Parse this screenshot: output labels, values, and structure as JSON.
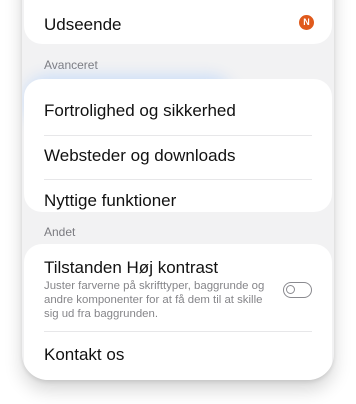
{
  "appearance": {
    "label": "Udseende",
    "badge": "N"
  },
  "advanced": {
    "header": "Avanceret",
    "items": [
      {
        "label": "Fortrolighed og sikkerhed"
      },
      {
        "label": "Websteder og downloads"
      },
      {
        "label": "Nyttige funktioner"
      }
    ]
  },
  "other": {
    "header": "Andet",
    "high_contrast": {
      "label": "Tilstanden Høj kontrast",
      "description": "Juster farverne på skrifttyper, baggrunde og andre komponenter for at få dem til at skille sig ud fra baggrunden.",
      "enabled": false
    },
    "contact": {
      "label": "Kontakt os"
    }
  },
  "colors": {
    "badge": "#e05a1c",
    "highlight": "#8fc0ff",
    "background": "#f2f2f3"
  }
}
